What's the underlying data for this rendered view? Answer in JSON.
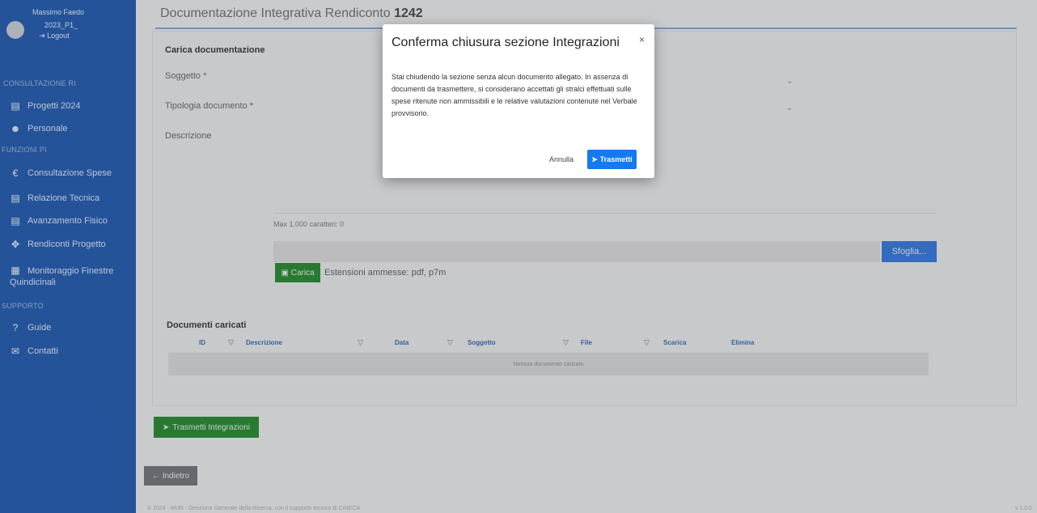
{
  "sidebar": {
    "user": {
      "name": "Massimo Faedo",
      "code": "2023_P1_",
      "logout": "Logout"
    },
    "sections": [
      {
        "label": "CONSULTAZIONE RI"
      },
      {
        "label": "FUNZIONI PI"
      },
      {
        "label": "SUPPORTO"
      }
    ],
    "items": [
      {
        "label": "Progetti 2024",
        "icon": "document-icon"
      },
      {
        "label": "Personale",
        "icon": "users-icon"
      },
      {
        "label": "Consultazione Spese",
        "icon": "euro-icon"
      },
      {
        "label": "Relazione Tecnica",
        "icon": "document-icon"
      },
      {
        "label": "Avanzamento Fisico",
        "icon": "document-icon"
      },
      {
        "label": "Rendiconti Progetto",
        "icon": "handshake-icon"
      },
      {
        "label": "Monitoraggio Finestre Quindicinali",
        "icon": "calendar-icon"
      },
      {
        "label": "Guide",
        "icon": "help-icon"
      },
      {
        "label": "Contatti",
        "icon": "mail-icon"
      }
    ]
  },
  "page": {
    "title": "Documentazione Integrativa Rendiconto",
    "title_number": "1242"
  },
  "form": {
    "section_title": "Carica documentazione",
    "subject_label": "Soggetto *",
    "doc_type_label": "Tipologia documento *",
    "description_label": "Descrizione",
    "max_chars": "Max 1.000 caratteri: 0",
    "browse_label": "Sfoglia...",
    "upload_label": "Carica",
    "extensions_note": "Estensioni ammesse: pdf, p7m"
  },
  "documents": {
    "title": "Documenti caricati",
    "columns": [
      "ID",
      "Descrizione",
      "Data",
      "Soggetto",
      "File",
      "Scarica",
      "Elimina"
    ],
    "empty_text": "Nessun documento caricato"
  },
  "actions": {
    "send_integrations": "Trasmetti Integrazioni",
    "back": "Indietro"
  },
  "footer": {
    "text": "© 2024 - MUR - Direzione Generale della Ricerca, con il supporto tecnico di CINECA",
    "version": "v 1.0.0"
  },
  "modal": {
    "title": "Conferma chiusura sezione Integrazioni",
    "close": "×",
    "body": "Stai chiudendo la sezione senza alcun documento allegato. In assenza di documenti da trasmettere, si considerano accettati gli stralci effettuati sulle spese ritenute non ammissibili e le relative valutazioni contenute nel Verbale provvisorio.",
    "cancel_label": "Annulla",
    "confirm_label": "Trasmetti"
  },
  "colors": {
    "sidebar": "#2a5fb0",
    "primary": "#1479f2",
    "success": "#2f8a3a"
  }
}
